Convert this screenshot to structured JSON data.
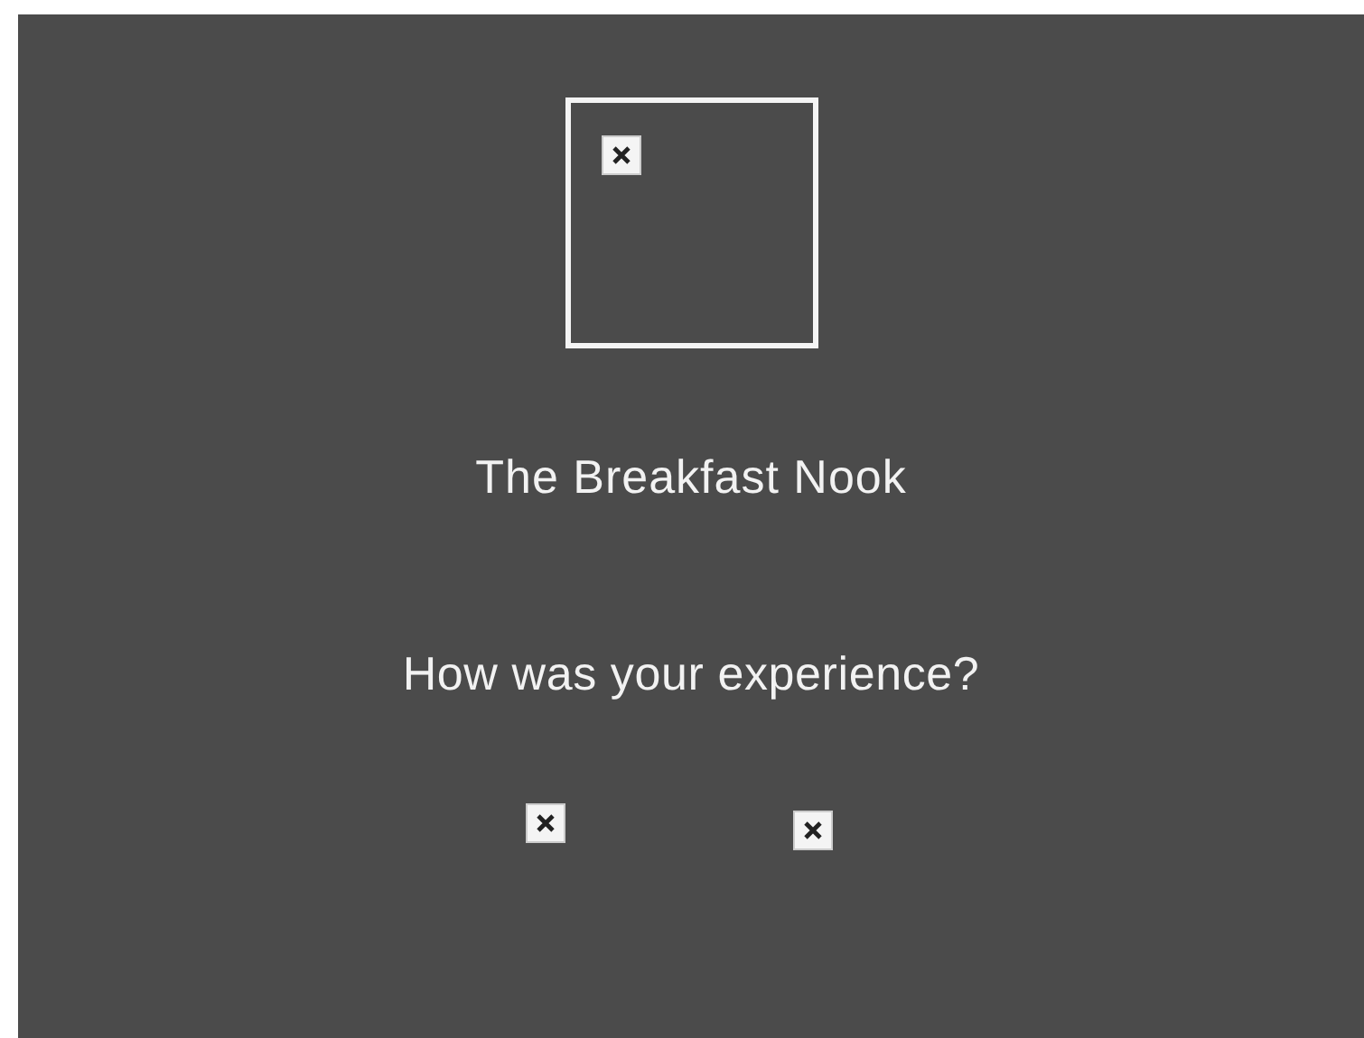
{
  "venue": {
    "name": "The Breakfast Nook"
  },
  "survey": {
    "question": "How was your experience?"
  }
}
